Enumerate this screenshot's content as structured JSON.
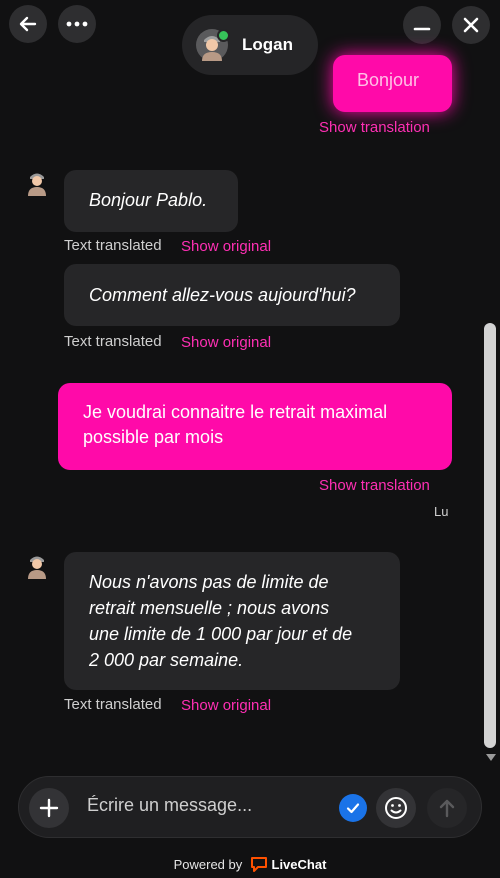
{
  "header": {
    "agent_name": "Logan",
    "icons": {
      "back": "arrow-left-icon",
      "more": "more-horizontal-icon",
      "minimize": "minimize-icon",
      "close": "close-icon"
    }
  },
  "messages": {
    "m1": {
      "text": "Bonjour",
      "link": "Show translation"
    },
    "m2": {
      "text": "Bonjour Pablo.",
      "status": "Text translated",
      "link": "Show original"
    },
    "m3": {
      "text": "Comment allez-vous aujourd'hui?",
      "status": "Text translated",
      "link": "Show original"
    },
    "m4": {
      "line1": "Je voudrai connaitre le retrait maximal",
      "line2": "possible par mois",
      "link": "Show translation",
      "read_status": "Lu"
    },
    "m5": {
      "line1": "Nous n'avons pas de limite de",
      "line2": "retrait mensuelle ; nous avons",
      "line3": "une limite de 1 000 par jour et de",
      "line4": "2 000 par semaine.",
      "status": "Text translated",
      "link": "Show original"
    }
  },
  "composer": {
    "placeholder": "Écrire un message..."
  },
  "footer": {
    "powered_by": "Powered by",
    "brand": "LiveChat"
  },
  "colors": {
    "accent": "#ff0aa9",
    "link": "#ff2fb4",
    "background": "#111112",
    "bubble_in": "#262628"
  }
}
